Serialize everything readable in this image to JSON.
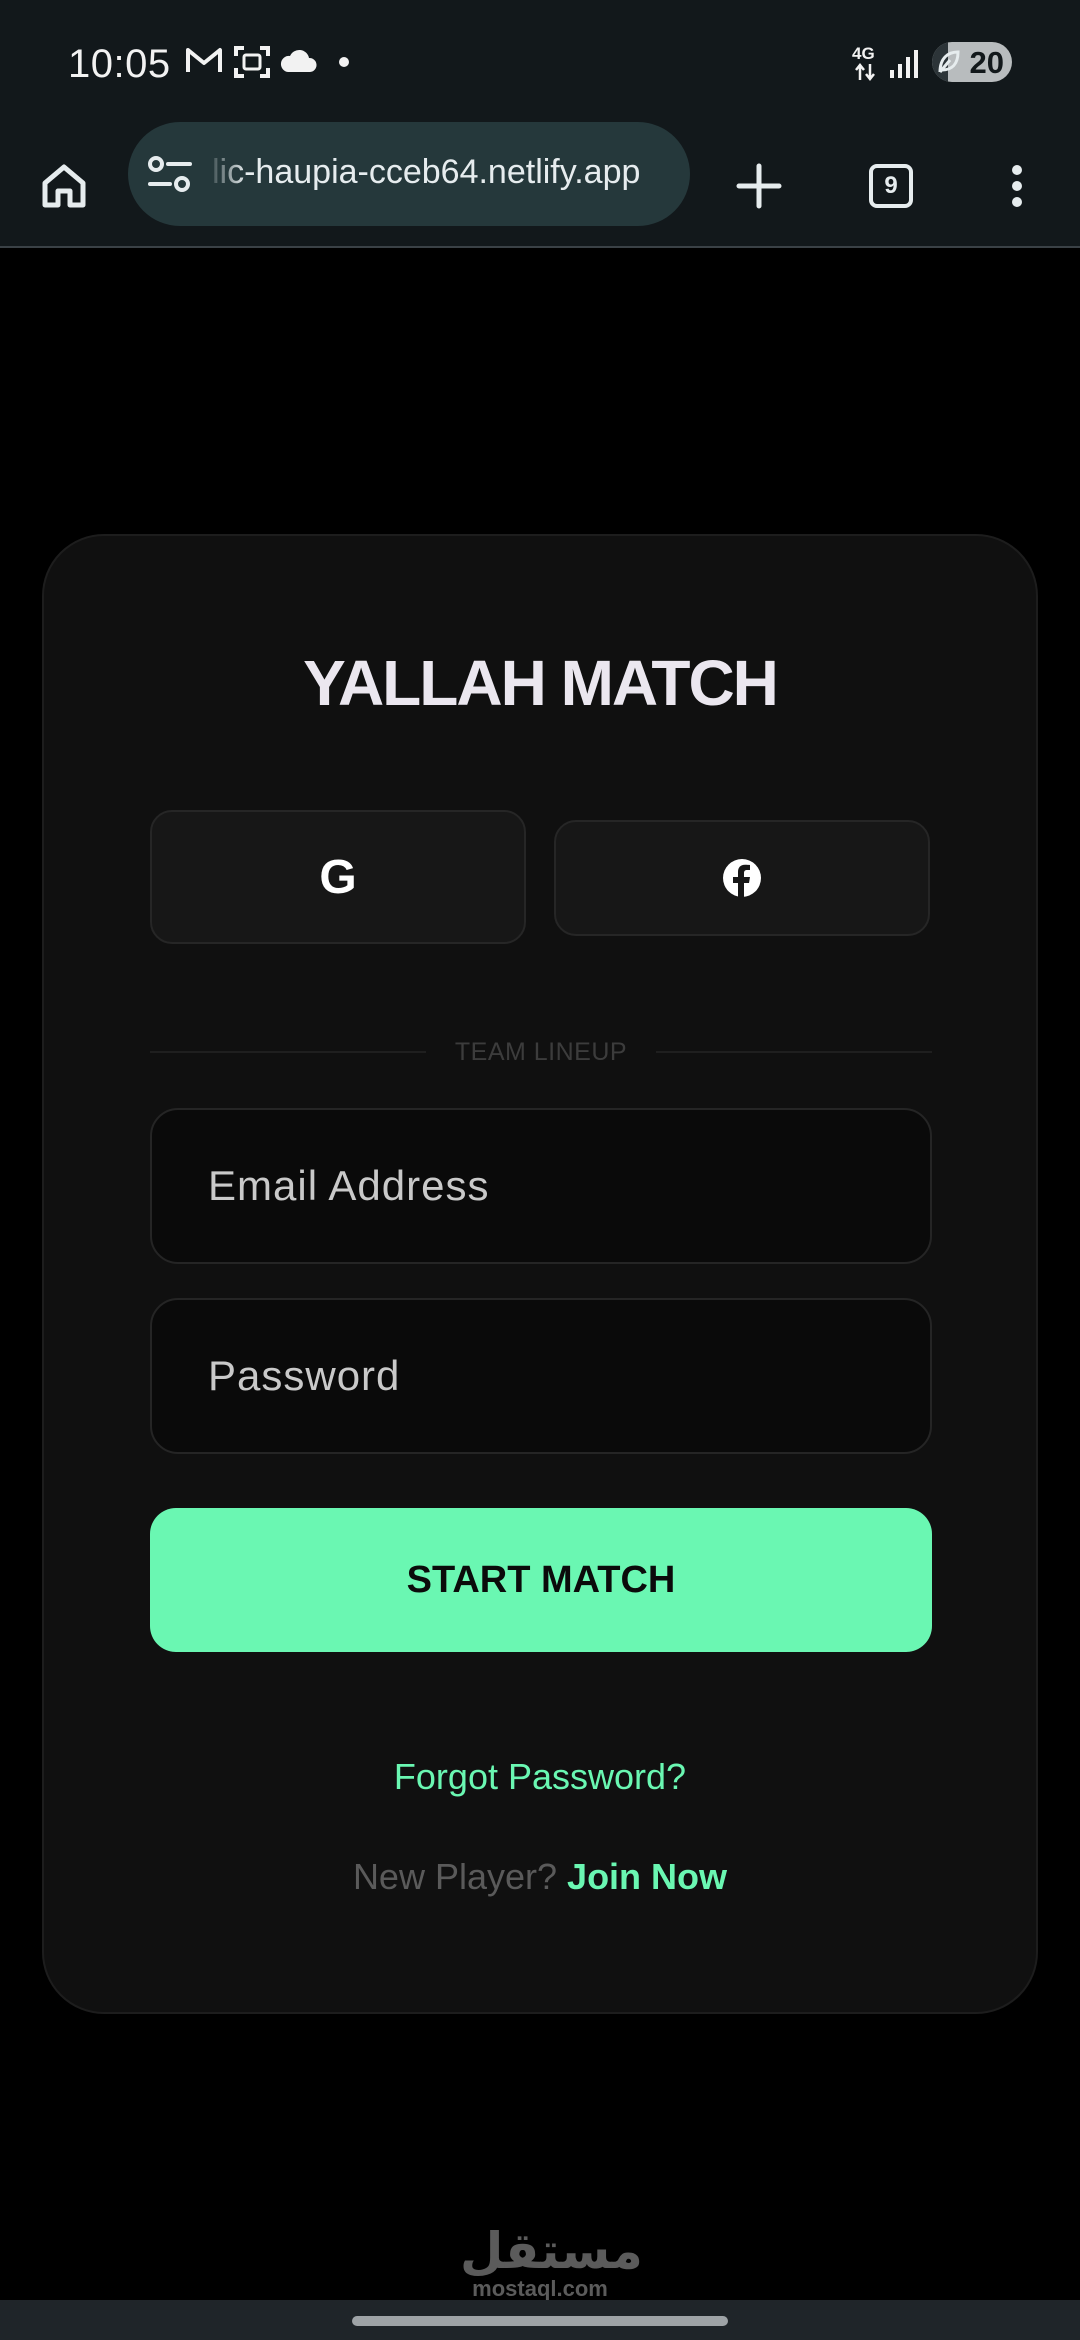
{
  "status_bar": {
    "time": "10:05",
    "notification_icons": [
      "gmail-icon",
      "screenshot-icon",
      "cloud-icon",
      "dot-icon"
    ],
    "network_label": "4G",
    "battery_level": "20",
    "battery_fraction": 0.2
  },
  "browser": {
    "url": "lic-haupia-cceb64.netlify.app",
    "tab_count": "9"
  },
  "card": {
    "title": "YALLAH MATCH",
    "google_label": "G",
    "divider_text": "TEAM LINEUP",
    "email_placeholder": "Email Address",
    "password_placeholder": "Password",
    "submit_label": "START MATCH",
    "forgot_password": "Forgot Password?",
    "new_player_prefix": "New Player?",
    "join_now": "Join Now"
  },
  "watermark": {
    "arabic": "مستقل",
    "latin": "mostaql.com"
  },
  "colors": {
    "accent": "#6af7b2",
    "background": "#000000",
    "card": "#101010",
    "toolbar": "#12181b",
    "url_bar": "#25383b"
  }
}
